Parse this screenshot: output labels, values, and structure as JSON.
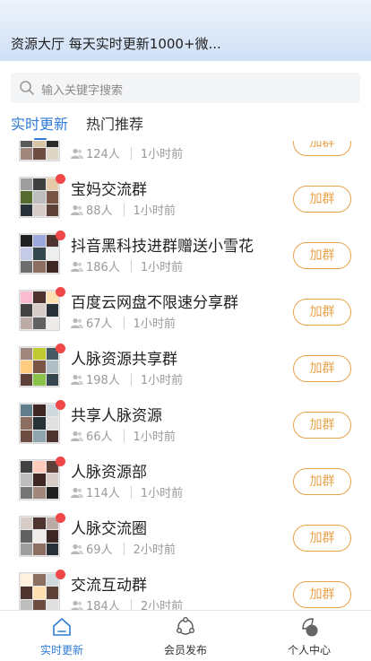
{
  "header": {
    "title": "资源大厅 每天实时更新1000+微..."
  },
  "search": {
    "placeholder": "输入关键字搜索"
  },
  "tabs": [
    {
      "label": "实时更新",
      "active": true
    },
    {
      "label": "热门推荐",
      "active": false
    }
  ],
  "join_label": "加群",
  "groups": [
    {
      "name": "",
      "members": "124人",
      "time": "1小时前",
      "partial": true
    },
    {
      "name": "宝妈交流群",
      "members": "88人",
      "time": "1小时前"
    },
    {
      "name": "抖音黑科技进群赠送小雪花",
      "members": "186人",
      "time": "1小时前"
    },
    {
      "name": "百度云网盘不限速分享群",
      "members": "67人",
      "time": "1小时前"
    },
    {
      "name": "人脉资源共享群",
      "members": "198人",
      "time": "1小时前"
    },
    {
      "name": "共享人脉资源",
      "members": "66人",
      "time": "1小时前"
    },
    {
      "name": "人脉资源部",
      "members": "114人",
      "time": "1小时前"
    },
    {
      "name": "人脉交流圈",
      "members": "69人",
      "time": "2小时前"
    },
    {
      "name": "交流互动群",
      "members": "184人",
      "time": "2小时前"
    }
  ],
  "footer": {
    "items": [
      {
        "label": "实时更新",
        "icon": "home-icon",
        "active": true
      },
      {
        "label": "会员发布",
        "icon": "share-icon",
        "active": false
      },
      {
        "label": "个人中心",
        "icon": "profile-icon",
        "active": false
      }
    ]
  },
  "colors": {
    "accent": "#2f7bd6",
    "join": "#e8a24a",
    "badge": "#f04848"
  }
}
